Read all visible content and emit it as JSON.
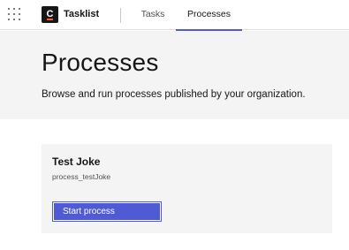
{
  "header": {
    "app_name": "Tasklist",
    "logo_letter": "C",
    "switcher_icon": "app-switcher-grid-icon",
    "tabs": [
      {
        "label": "Tasks",
        "active": false
      },
      {
        "label": "Processes",
        "active": true
      }
    ],
    "accent_color": "#4f5bd5"
  },
  "main": {
    "title": "Processes",
    "subtitle": "Browse and run processes published by your organization.",
    "processes": [
      {
        "name": "Test Joke",
        "id": "process_testJoke",
        "start_label": "Start process"
      }
    ]
  }
}
